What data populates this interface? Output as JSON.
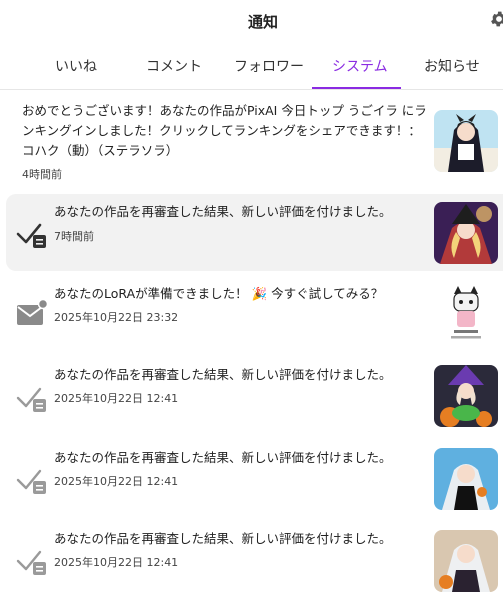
{
  "header": {
    "title": "通知",
    "settings_icon": "gear-icon"
  },
  "tabs": [
    {
      "label": "いいね",
      "active": false
    },
    {
      "label": "コメント",
      "active": false
    },
    {
      "label": "フォロワー",
      "active": false
    },
    {
      "label": "システム",
      "active": true
    },
    {
      "label": "お知らせ",
      "active": false
    }
  ],
  "accent_color": "#8a2be2",
  "notifications": [
    {
      "icon": "none",
      "text": "おめでとうございます！あなたの作品がPixAI 今日トップ うごイラ にランキングインしました！クリックしてランキングをシェアできます！： コハク（動）（ステラソラ）",
      "time": "4時間前",
      "highlight": false
    },
    {
      "icon": "check-review-icon",
      "text": "あなたの作品を再審査した結果、新しい評価を付けました。",
      "time": "7時間前",
      "highlight": true
    },
    {
      "icon": "mail-icon",
      "text": "あなたのLoRAが準備できました！ 🎉 今すぐ試してみる？",
      "time": "2025年10月22日 23:32",
      "highlight": false
    },
    {
      "icon": "check-review-icon",
      "text": "あなたの作品を再審査した結果、新しい評価を付けました。",
      "time": "2025年10月22日 12:41",
      "highlight": false
    },
    {
      "icon": "check-review-icon",
      "text": "あなたの作品を再審査した結果、新しい評価を付けました。",
      "time": "2025年10月22日 12:41",
      "highlight": false
    },
    {
      "icon": "check-review-icon",
      "text": "あなたの作品を再審査した結果、新しい評価を付けました。",
      "time": "2025年10月22日 12:41",
      "highlight": false
    }
  ]
}
